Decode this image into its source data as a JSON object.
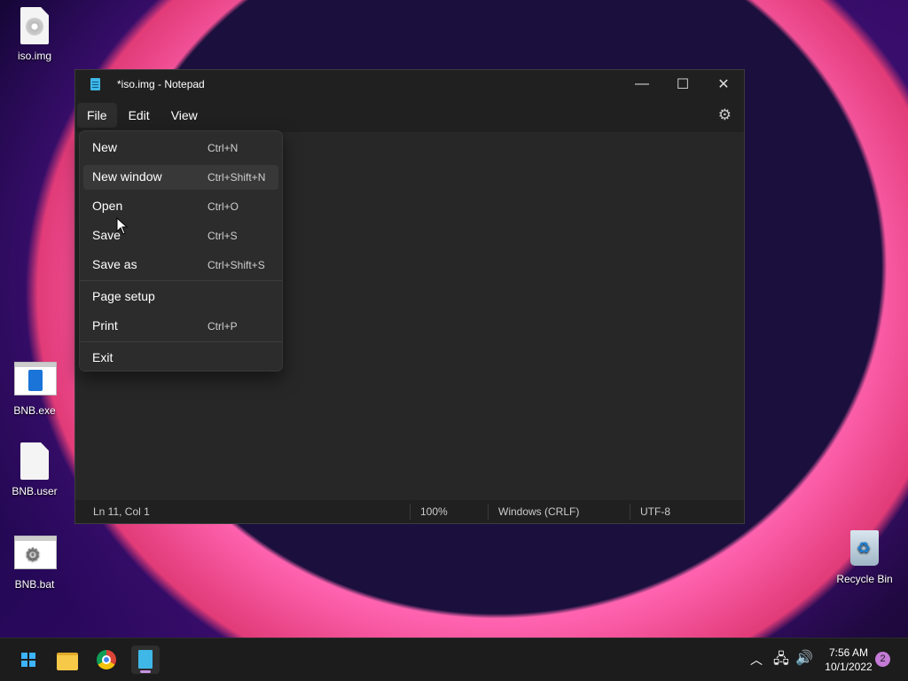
{
  "desktop": {
    "icons": [
      {
        "label": "iso.img",
        "icon": "disc-image-icon"
      },
      {
        "label": "BNB.exe",
        "icon": "executable-icon"
      },
      {
        "label": "BNB.user",
        "icon": "file-icon"
      },
      {
        "label": "BNB.bat",
        "icon": "batch-file-icon"
      },
      {
        "label": "Recycle Bin",
        "icon": "recycle-bin-icon"
      }
    ]
  },
  "window": {
    "title": "*iso.img - Notepad",
    "menu": {
      "file": "File",
      "edit": "Edit",
      "view": "View"
    },
    "controls": {
      "minimize": "—",
      "maximize": "☐",
      "close": "✕"
    },
    "settings_icon": "⚙"
  },
  "file_menu": {
    "items": [
      {
        "label": "New",
        "shortcut": "Ctrl+N"
      },
      {
        "label": "New window",
        "shortcut": "Ctrl+Shift+N"
      },
      {
        "label": "Open",
        "shortcut": "Ctrl+O"
      },
      {
        "label": "Save",
        "shortcut": "Ctrl+S"
      },
      {
        "label": "Save as",
        "shortcut": "Ctrl+Shift+S"
      },
      {
        "label": "Page setup",
        "shortcut": ""
      },
      {
        "label": "Print",
        "shortcut": "Ctrl+P"
      },
      {
        "label": "Exit",
        "shortcut": ""
      }
    ]
  },
  "statusbar": {
    "position": "Ln 11, Col 1",
    "zoom": "100%",
    "line_ending": "Windows (CRLF)",
    "encoding": "UTF-8"
  },
  "taskbar": {
    "clock_time": "7:56 AM",
    "clock_date": "10/1/2022",
    "notification_count": "2"
  },
  "colors": {
    "accent": "#3cb4ff",
    "menu_bg": "#2c2c2c",
    "window_bg": "#272727"
  }
}
